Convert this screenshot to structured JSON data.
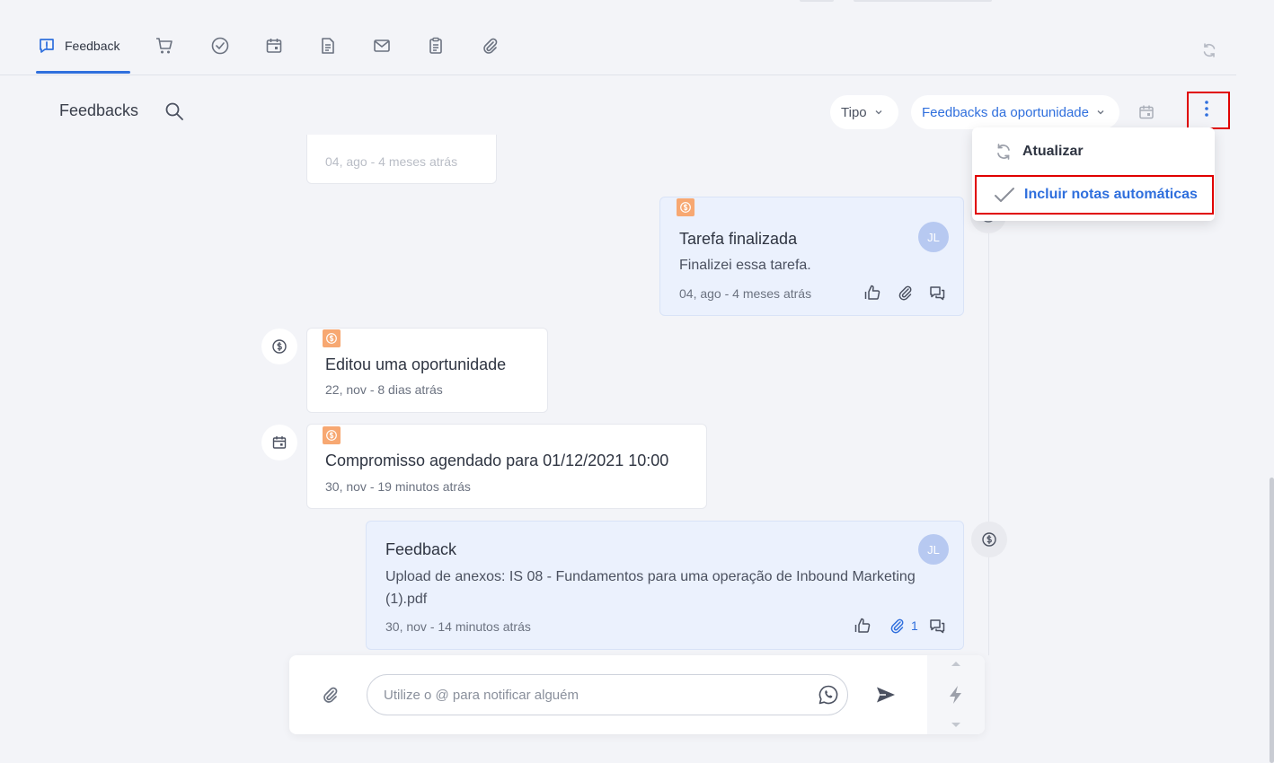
{
  "tabs": [
    {
      "label": "Feedback",
      "icon": "alert-square-icon"
    },
    {
      "icon": "cart-icon"
    },
    {
      "icon": "check-circle-icon"
    },
    {
      "icon": "calendar-icon"
    },
    {
      "icon": "document-icon"
    },
    {
      "icon": "mail-icon"
    },
    {
      "icon": "clipboard-icon"
    },
    {
      "icon": "paperclip-icon"
    }
  ],
  "header": {
    "title": "Feedbacks",
    "type_filter": "Tipo",
    "scope_filter": "Feedbacks da oportunidade"
  },
  "menu": {
    "items": [
      {
        "label": "Atualizar",
        "icon": "refresh-icon"
      },
      {
        "label": "Incluir notas automáticas",
        "icon": "check-icon"
      }
    ]
  },
  "timeline": {
    "partial_meta": "04, ago - 4 meses atrás",
    "entries": [
      {
        "title": "Tarefa finalizada",
        "text": "Finalizei essa tarefa.",
        "meta": "04, ago - 4 meses atrás",
        "avatar": "JL"
      },
      {
        "title": "Editou uma oportunidade",
        "meta": "22, nov - 8 dias atrás"
      },
      {
        "title": "Compromisso agendado para 01/12/2021 10:00",
        "meta": "30, nov - 19 minutos atrás"
      },
      {
        "title": "Feedback",
        "text_line1": "Upload de anexos: IS 08 - Fundamentos para uma operação de Inbound Marketing",
        "text_line2": "(1).pdf",
        "meta": "30, nov - 14 minutos atrás",
        "avatar": "JL",
        "attachments": "1"
      }
    ]
  },
  "composer": {
    "placeholder": "Utilize o @ para notificar alguém"
  },
  "colors": {
    "accent": "#2f6fdd",
    "highlight": "#e00000",
    "badge": "#f7a872"
  }
}
